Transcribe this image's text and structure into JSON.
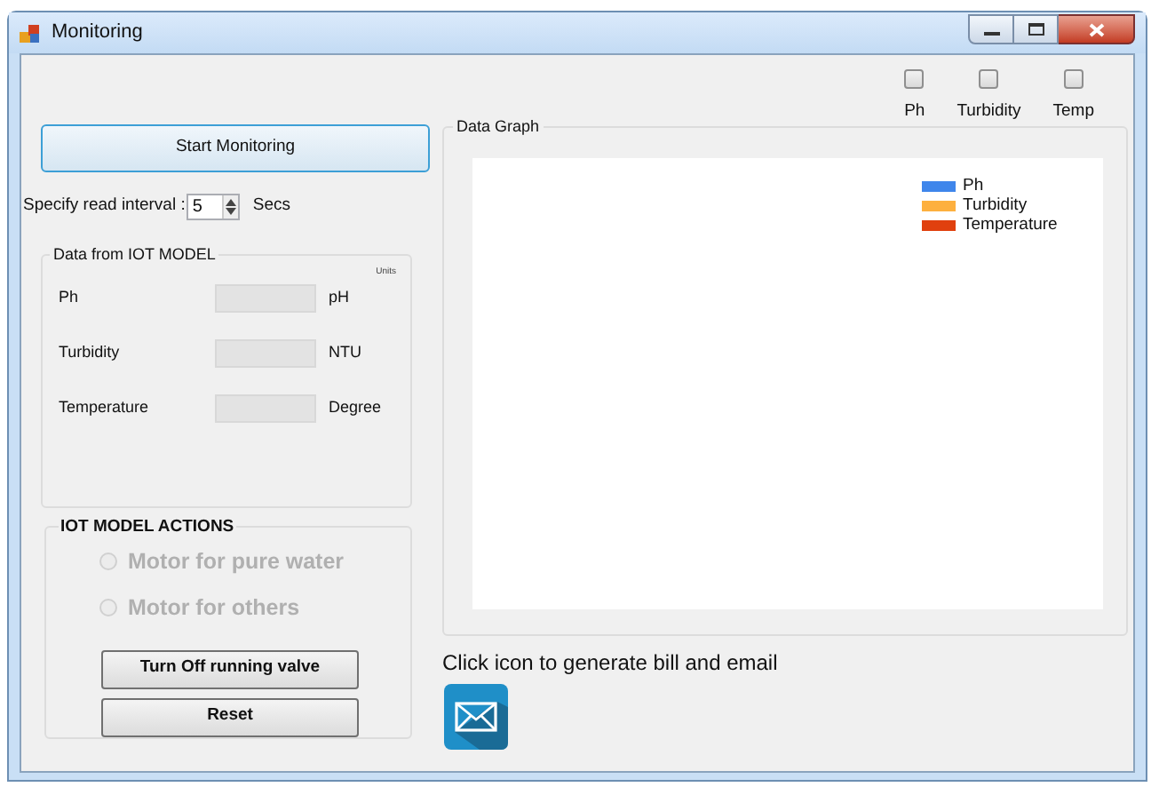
{
  "window": {
    "title": "Monitoring"
  },
  "series_toggles": [
    {
      "label": "Ph",
      "checked": false
    },
    {
      "label": "Turbidity",
      "checked": false
    },
    {
      "label": "Temp",
      "checked": false
    }
  ],
  "start_button": "Start Monitoring",
  "interval": {
    "label": "Specify read interval :",
    "value": "5",
    "unit": "Secs"
  },
  "data_group": {
    "title": "Data from IOT MODEL",
    "units_header": "Units",
    "readings": [
      {
        "label": "Ph",
        "unit": "pH"
      },
      {
        "label": "Turbidity",
        "unit": "NTU"
      },
      {
        "label": "Temperature",
        "unit": "Degree"
      }
    ]
  },
  "actions_group": {
    "title": "IOT MODEL ACTIONS",
    "options": [
      {
        "label": "Motor for pure water",
        "selected": false,
        "disabled": true
      },
      {
        "label": "Motor for others",
        "selected": false,
        "disabled": true
      }
    ],
    "buttons": [
      "Turn Off running valve",
      "Reset"
    ]
  },
  "graph": {
    "title": "Data Graph",
    "legend": [
      {
        "name": "Ph",
        "color": "#3f86eb"
      },
      {
        "name": "Turbidity",
        "color": "#fdb03f"
      },
      {
        "name": "Temperature",
        "color": "#e0400e"
      }
    ]
  },
  "bill_hint": "Click icon to generate bill and email"
}
